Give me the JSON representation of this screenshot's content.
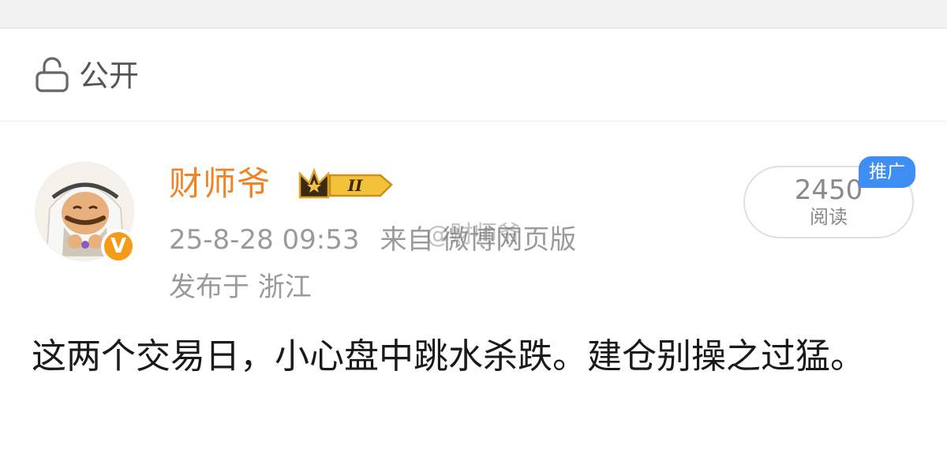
{
  "visibility": {
    "label": "公开",
    "icon": "lock-open-icon"
  },
  "author": {
    "name": "财师爷",
    "vip_badge": "II",
    "verified_badge": "V",
    "avatar": "avatar-image",
    "name_color": "#f08327"
  },
  "meta": {
    "timestamp": "25-8-28 09:53",
    "source": "来自 微博网页版",
    "location": "发布于 浙江"
  },
  "views": {
    "count": "2450",
    "label": "阅读",
    "promo": "推广",
    "promo_color": "#3f8ef3"
  },
  "watermark": "@财师爷",
  "post": {
    "text": "这两个交易日，小心盘中跳水杀跌。建仓别操之过猛。"
  }
}
